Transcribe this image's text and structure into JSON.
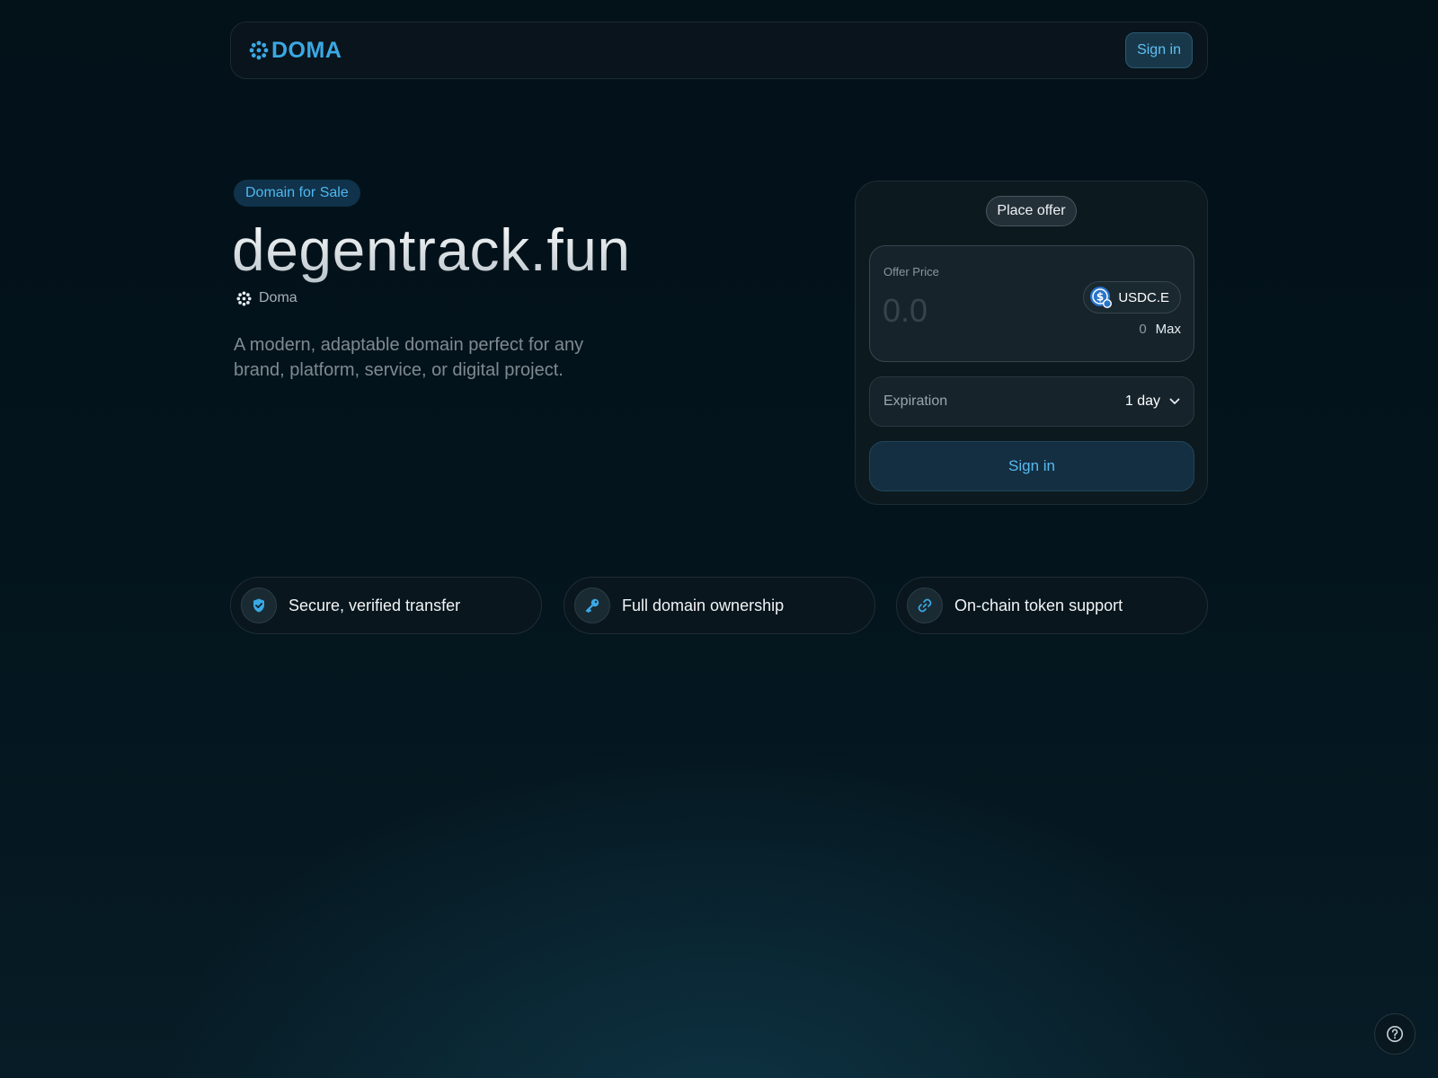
{
  "header": {
    "logo_text": "DOMA",
    "signin_label": "Sign in"
  },
  "hero": {
    "badge": "Domain for Sale",
    "domain_name": "degentrack.fun",
    "registrar": "Doma",
    "description": "A modern, adaptable domain perfect for any brand, platform, service, or digital project."
  },
  "offer": {
    "tab_label": "Place offer",
    "price_label": "Offer Price",
    "price_placeholder": "0.0",
    "token": "USDC.E",
    "balance": "0",
    "max_label": "Max",
    "expiration_label": "Expiration",
    "expiration_value": "1 day",
    "submit_label": "Sign in"
  },
  "features": [
    {
      "label": "Secure, verified transfer",
      "icon": "shield-check-icon"
    },
    {
      "label": "Full domain ownership",
      "icon": "key-icon"
    },
    {
      "label": "On-chain token support",
      "icon": "link-icon"
    }
  ],
  "colors": {
    "accent": "#3aa8e4",
    "background": "#03141c",
    "badge_bg": "#10324a"
  }
}
